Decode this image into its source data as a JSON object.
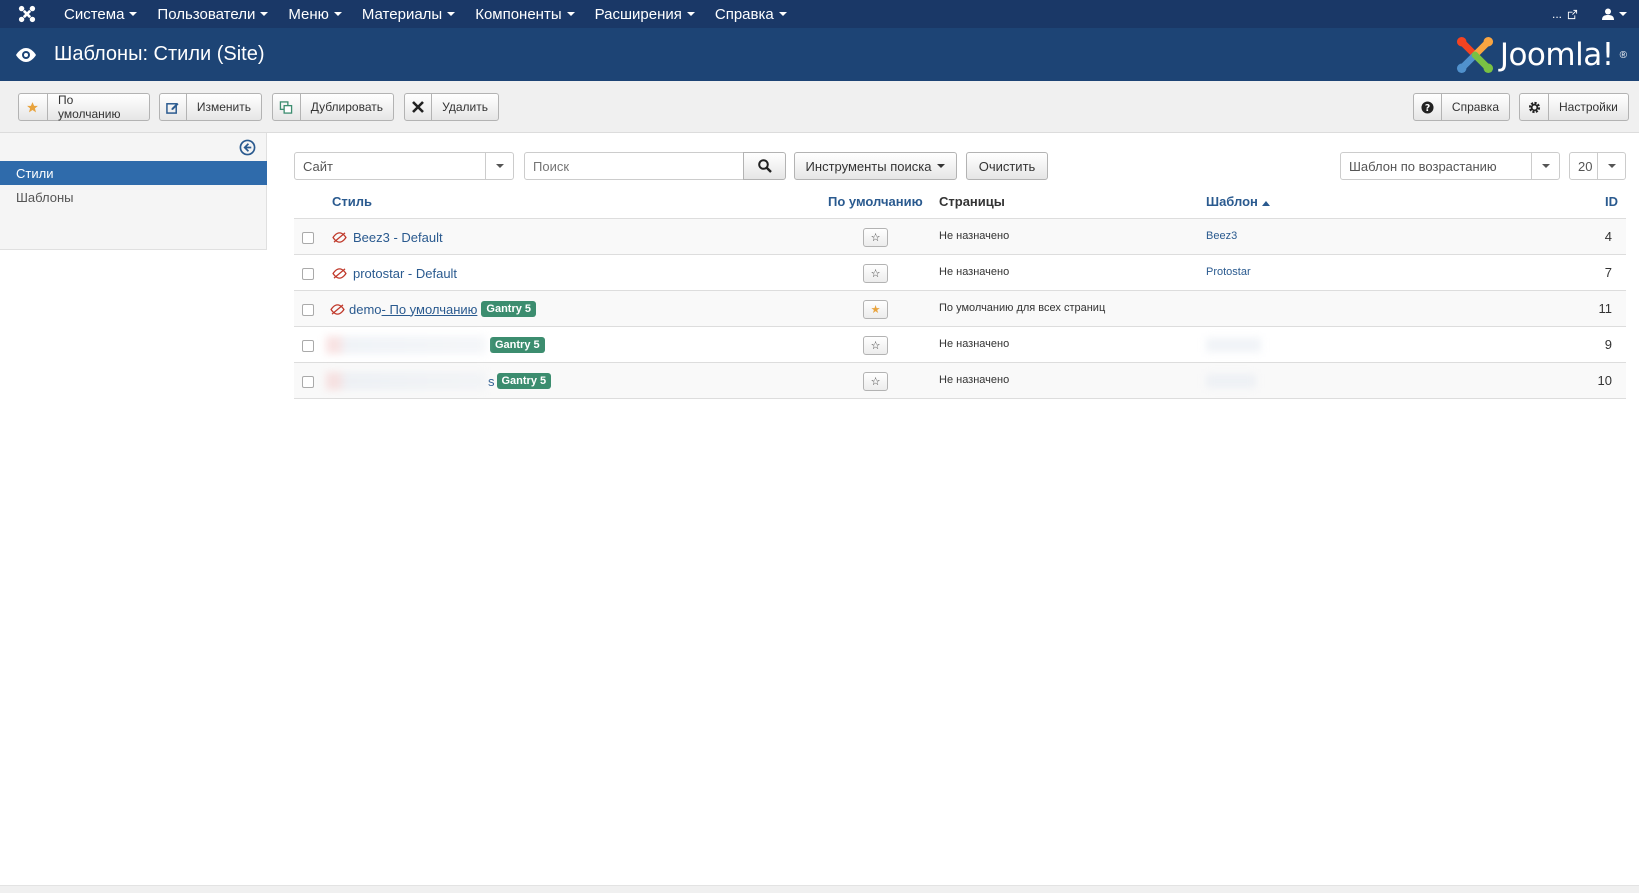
{
  "topbar": {
    "menus": [
      "Система",
      "Пользователи",
      "Меню",
      "Материалы",
      "Компоненты",
      "Расширения",
      "Справка"
    ],
    "right_link": "...",
    "user_icon": "user-icon"
  },
  "header": {
    "title": "Шаблоны: Стили (Site)",
    "logo_text": "Joomla!",
    "logo_reg": "®"
  },
  "toolbar": {
    "default_label": "По умолчанию",
    "edit_label": "Изменить",
    "duplicate_label": "Дублировать",
    "delete_label": "Удалить",
    "help_label": "Справка",
    "options_label": "Настройки"
  },
  "sidebar": {
    "items": [
      {
        "label": "Стили",
        "active": true
      },
      {
        "label": "Шаблоны",
        "active": false
      }
    ]
  },
  "filters": {
    "client_select": "Сайт",
    "search_placeholder": "Поиск",
    "search_tools_label": "Инструменты поиска",
    "clear_label": "Очистить",
    "ordering_select": "Шаблон по возрастанию",
    "limit_select": "20"
  },
  "table": {
    "headers": {
      "style": "Стиль",
      "default": "По умолчанию",
      "pages": "Страницы",
      "template": "Шаблон",
      "id": "ID"
    },
    "rows": [
      {
        "style": "Beez3 - Default",
        "badge": "",
        "default": false,
        "pages": "Не назначено",
        "template": "Beez3",
        "id": "4"
      },
      {
        "style": "protostar - Default",
        "badge": "",
        "default": false,
        "pages": "Не назначено",
        "template": "Protostar",
        "id": "7"
      },
      {
        "style_prefix": "demo",
        "style": "- По умолчанию",
        "badge": "Gantry 5",
        "default": true,
        "pages": "По умолчанию для всех страниц",
        "template": "",
        "id": "11"
      },
      {
        "style": "",
        "badge": "Gantry 5",
        "default": false,
        "pages": "Не назначено",
        "template": "",
        "id": "9"
      },
      {
        "style_suffix": "s",
        "badge": "Gantry 5",
        "default": false,
        "pages": "Не назначено",
        "template": "",
        "id": "10"
      }
    ]
  },
  "colors": {
    "topbar": "#1a3867",
    "header": "#1d4475",
    "link": "#2a5a8f",
    "active": "#2f6bab",
    "badge": "#3c8d6f",
    "star_on": "#e8a33d"
  }
}
